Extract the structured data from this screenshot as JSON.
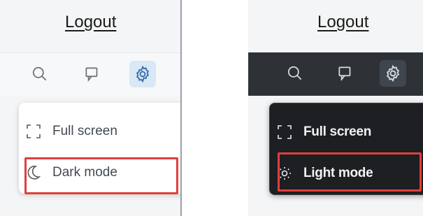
{
  "light_panel": {
    "logout_label": "Logout",
    "menu": {
      "fullscreen_label": "Full screen",
      "mode_label": "Dark mode"
    }
  },
  "dark_panel": {
    "logout_label": "Logout",
    "menu": {
      "fullscreen_label": "Full screen",
      "mode_label": "Light mode"
    }
  },
  "colors": {
    "highlight": "#e0403c",
    "dark_toolbar": "#2e3237",
    "dark_menu": "#1d1f22",
    "active_gear_light": "#d8e8f6"
  },
  "icons": {
    "toolbar": [
      "search-icon",
      "chat-icon",
      "gear-icon"
    ],
    "menu_light": [
      "fullscreen-icon",
      "moon-icon"
    ],
    "menu_dark": [
      "fullscreen-icon",
      "sun-icon"
    ]
  }
}
